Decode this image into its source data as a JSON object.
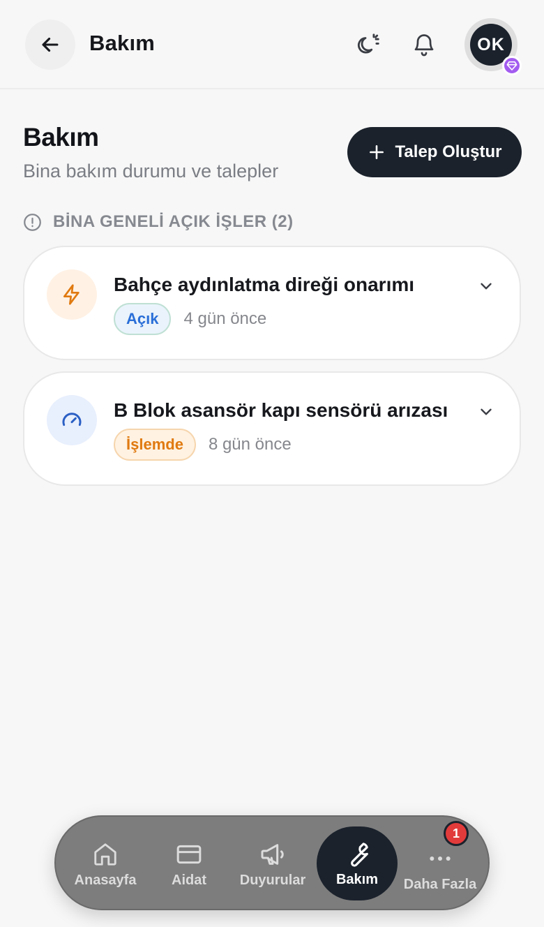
{
  "header": {
    "title": "Bakım",
    "avatar_initials": "OK"
  },
  "page": {
    "title": "Bakım",
    "subtitle": "Bina bakım durumu ve talepler",
    "create_button_label": "Talep Oluştur"
  },
  "section": {
    "label": "BİNA GENELİ AÇIK İŞLER (2)"
  },
  "items": [
    {
      "title": "Bahçe aydınlatma direği onarımı",
      "status": "Açık",
      "time_ago": "4 gün önce",
      "icon": "bolt-icon",
      "status_color": "#2a6fd8"
    },
    {
      "title": "B Blok asansör kapı sensörü arızası",
      "status": "İşlemde",
      "time_ago": "8 gün önce",
      "icon": "gauge-icon",
      "status_color": "#e07a10"
    }
  ],
  "nav": {
    "home": "Anasayfa",
    "dues": "Aidat",
    "announcements": "Duyurular",
    "maintenance": "Bakım",
    "more": "Daha Fazla",
    "more_badge": "1"
  },
  "colors": {
    "primary_dark": "#1b222c",
    "premium_badge": "#a35cf0",
    "notification_badge": "#e23b3b"
  }
}
